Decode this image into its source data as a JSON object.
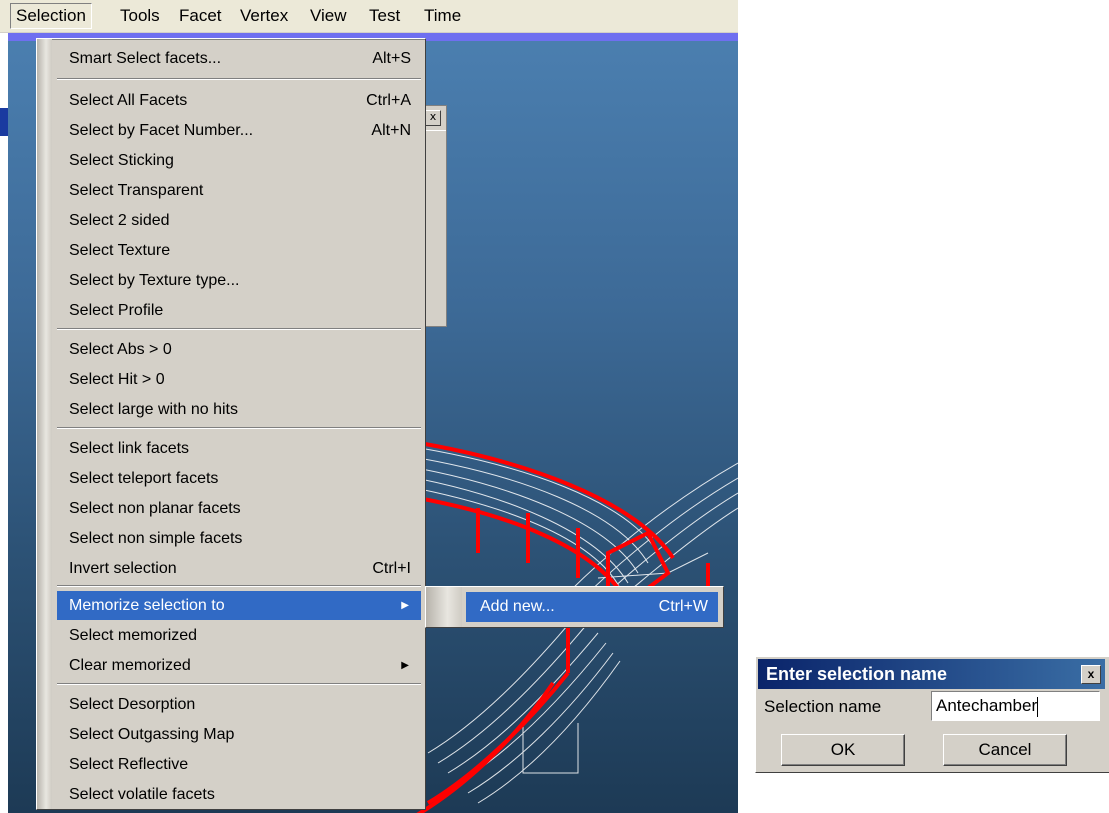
{
  "menubar": {
    "items": [
      "Selection",
      "Tools",
      "Facet",
      "Vertex",
      "View",
      "Test",
      "Time"
    ],
    "open_index": 0
  },
  "selection_menu": {
    "items": [
      {
        "label": "Smart Select facets...",
        "shortcut": "Alt+S"
      },
      {
        "label": "Select All Facets",
        "shortcut": "Ctrl+A"
      },
      {
        "label": "Select by Facet Number...",
        "shortcut": "Alt+N"
      },
      {
        "label": "Select Sticking",
        "shortcut": ""
      },
      {
        "label": "Select Transparent",
        "shortcut": ""
      },
      {
        "label": "Select 2 sided",
        "shortcut": ""
      },
      {
        "label": "Select Texture",
        "shortcut": ""
      },
      {
        "label": "Select by Texture type...",
        "shortcut": ""
      },
      {
        "label": "Select Profile",
        "shortcut": ""
      },
      {
        "label": "Select Abs > 0",
        "shortcut": ""
      },
      {
        "label": "Select Hit > 0",
        "shortcut": ""
      },
      {
        "label": "Select large with no hits",
        "shortcut": ""
      },
      {
        "label": "Select link facets",
        "shortcut": ""
      },
      {
        "label": "Select teleport facets",
        "shortcut": ""
      },
      {
        "label": "Select non planar facets",
        "shortcut": ""
      },
      {
        "label": "Select non simple facets",
        "shortcut": ""
      },
      {
        "label": "Invert selection",
        "shortcut": "Ctrl+I"
      },
      {
        "label": "Memorize selection to",
        "shortcut": "",
        "submenu": true,
        "highlighted": true
      },
      {
        "label": "Select memorized",
        "shortcut": ""
      },
      {
        "label": "Clear memorized",
        "shortcut": "",
        "submenu": true
      },
      {
        "label": "Select Desorption",
        "shortcut": ""
      },
      {
        "label": "Select Outgassing Map",
        "shortcut": ""
      },
      {
        "label": "Select Reflective",
        "shortcut": ""
      },
      {
        "label": "Select volatile facets",
        "shortcut": ""
      }
    ]
  },
  "submenu": {
    "item_label": "Add new...",
    "item_shortcut": "Ctrl+W"
  },
  "dialog": {
    "title": "Enter selection name",
    "close_glyph": "x",
    "field_label": "Selection name",
    "field_value": "Antechamber",
    "ok_label": "OK",
    "cancel_label": "Cancel"
  },
  "panel": {
    "close_glyph": "x"
  },
  "colors": {
    "menu_bg": "#d4d0c8",
    "highlight": "#316ac5",
    "title_bar": "#0a246a",
    "viewport_top": "#4b7fb0",
    "viewport_bottom": "#1d3a55",
    "facet_outline": "#ff0000"
  }
}
